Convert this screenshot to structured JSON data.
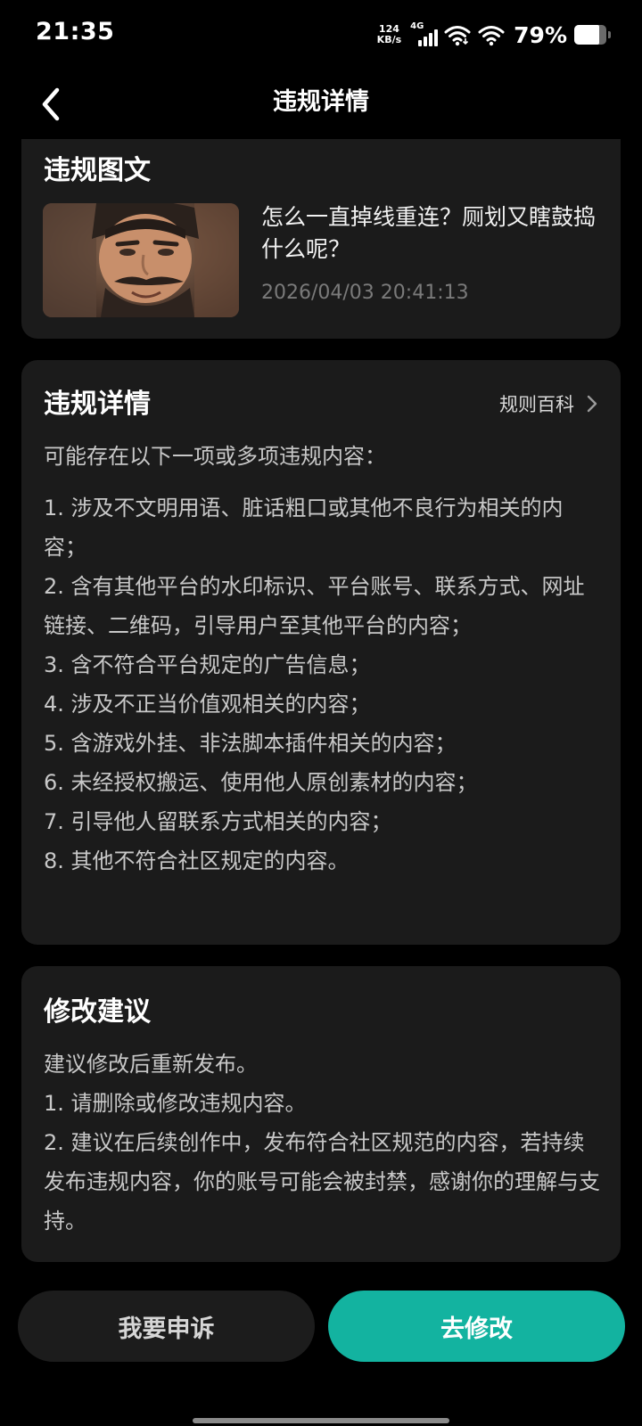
{
  "status_bar": {
    "time": "21:35",
    "net_speed_value": "124",
    "net_speed_unit": "KB/s",
    "signal_label": "4G",
    "battery_percent": "79%",
    "battery_level": 0.79,
    "icons": [
      "signal-icon",
      "wifi-icon",
      "wifi-icon",
      "battery-icon"
    ]
  },
  "nav": {
    "title": "违规详情",
    "back_icon": "chevron-left-icon"
  },
  "post": {
    "heading": "违规图文",
    "title": "怎么一直掉线重连？厕划又瞎鼓捣什么呢？",
    "time": "2026/04/03 20:41:13"
  },
  "detail": {
    "heading": "违规详情",
    "rules_link": "规则百科",
    "intro": "可能存在以下一项或多项违规内容：",
    "items": [
      "1. 涉及不文明用语、脏话粗口或其他不良行为相关的内容；",
      "2. 含有其他平台的水印标识、平台账号、联系方式、网址链接、二维码，引导用户至其他平台的内容；",
      "3. 含不符合平台规定的广告信息；",
      "4. 涉及不正当价值观相关的内容；",
      "5. 含游戏外挂、非法脚本插件相关的内容；",
      "6. 未经授权搬运、使用他人原创素材的内容；",
      "7. 引导他人留联系方式相关的内容；",
      "8. 其他不符合社区规定的内容。"
    ]
  },
  "advice": {
    "heading": "修改建议",
    "lines": [
      "建议修改后重新发布。",
      "1. 请删除或修改违规内容。",
      "2. 建议在后续创作中，发布符合社区规范的内容，若持续发布违规内容，你的账号可能会被封禁，感谢你的理解与支持。"
    ]
  },
  "buttons": {
    "appeal": "我要申诉",
    "modify": "去修改"
  },
  "colors": {
    "background": "#000000",
    "card": "#1b1b1b",
    "accent": "#13b3a0",
    "muted_text": "#7a7a7a"
  }
}
